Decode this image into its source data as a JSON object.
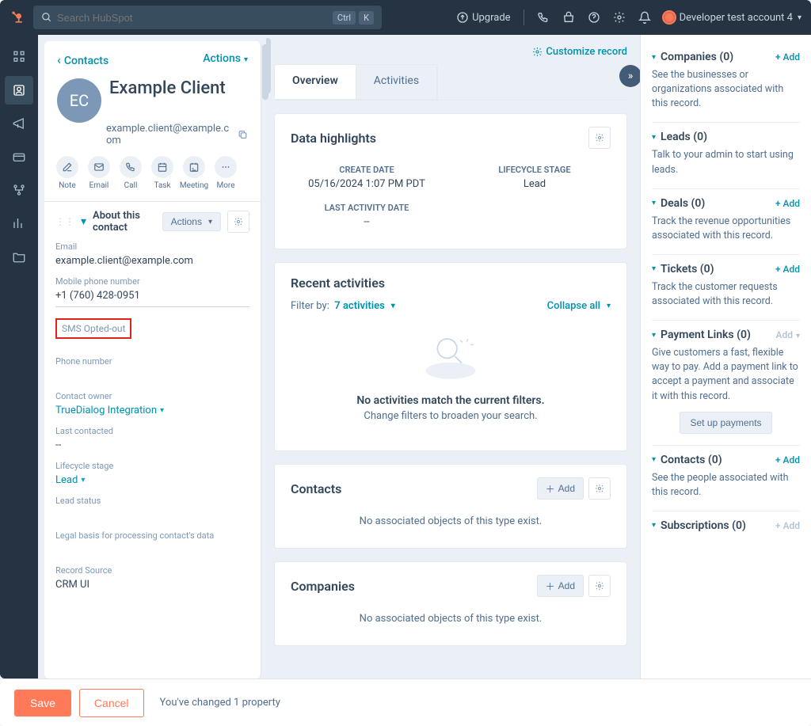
{
  "topnav": {
    "search_placeholder": "Search HubSpot",
    "kbd1": "Ctrl",
    "kbd2": "K",
    "upgrade": "Upgrade",
    "account": "Developer test account 4"
  },
  "left": {
    "crumb": "Contacts",
    "actions": "Actions",
    "avatar_initials": "EC",
    "person_name": "Example Client",
    "person_email": "example.client@example.com",
    "action_icons": [
      "Note",
      "Email",
      "Call",
      "Task",
      "Meeting",
      "More"
    ],
    "about": {
      "title": "About this contact",
      "actions": "Actions",
      "email_label": "Email",
      "email_val": "example.client@example.com",
      "mobile_label": "Mobile phone number",
      "mobile_val": "+1 (760) 428-0951",
      "sms_opt_label": "SMS Opted-out",
      "phone_label": "Phone number",
      "owner_label": "Contact owner",
      "owner_val": "TrueDialog Integration",
      "lastcontact_label": "Last contacted",
      "lastcontact_val": "--",
      "lifecycle_label": "Lifecycle stage",
      "lifecycle_val": "Lead",
      "leadstatus_label": "Lead status",
      "legal_label": "Legal basis for processing contact's data",
      "source_label": "Record Source",
      "source_val": "CRM UI"
    }
  },
  "mid": {
    "customize": "Customize record",
    "tabs": {
      "overview": "Overview",
      "activities": "Activities"
    },
    "highlights": {
      "title": "Data highlights",
      "create_label": "CREATE DATE",
      "create_val": "05/16/2024 1:07 PM PDT",
      "lifecycle_label": "LIFECYCLE STAGE",
      "lifecycle_val": "Lead",
      "lastact_label": "LAST ACTIVITY DATE",
      "lastact_val": "--"
    },
    "recent": {
      "title": "Recent activities",
      "filter_label": "Filter by:",
      "filter_val": "7 activities",
      "collapse": "Collapse all",
      "empty_h": "No activities match the current filters.",
      "empty_p": "Change filters to broaden your search."
    },
    "contacts": {
      "title": "Contacts",
      "add": "Add",
      "empty": "No associated objects of this type exist."
    },
    "companies": {
      "title": "Companies",
      "add": "Add",
      "empty": "No associated objects of this type exist."
    }
  },
  "right": {
    "add": "+ Add",
    "companies": {
      "title": "Companies (0)",
      "desc": "See the businesses or organizations associated with this record."
    },
    "leads": {
      "title": "Leads (0)",
      "desc": "Talk to your admin to start using leads."
    },
    "deals": {
      "title": "Deals (0)",
      "desc": "Track the revenue opportunities associated with this record."
    },
    "tickets": {
      "title": "Tickets (0)",
      "desc": "Track the customer requests associated with this record."
    },
    "paymentlinks": {
      "title": "Payment Links (0)",
      "add": "Add",
      "desc": "Give customers a fast, flexible way to pay. Add a payment link to accept a payment and associate it with this record.",
      "btn": "Set up payments"
    },
    "contacts": {
      "title": "Contacts (0)",
      "desc": "See the people associated with this record."
    },
    "subscriptions": {
      "title": "Subscriptions (0)"
    }
  },
  "footer": {
    "save": "Save",
    "cancel": "Cancel",
    "msg": "You've changed 1 property"
  }
}
